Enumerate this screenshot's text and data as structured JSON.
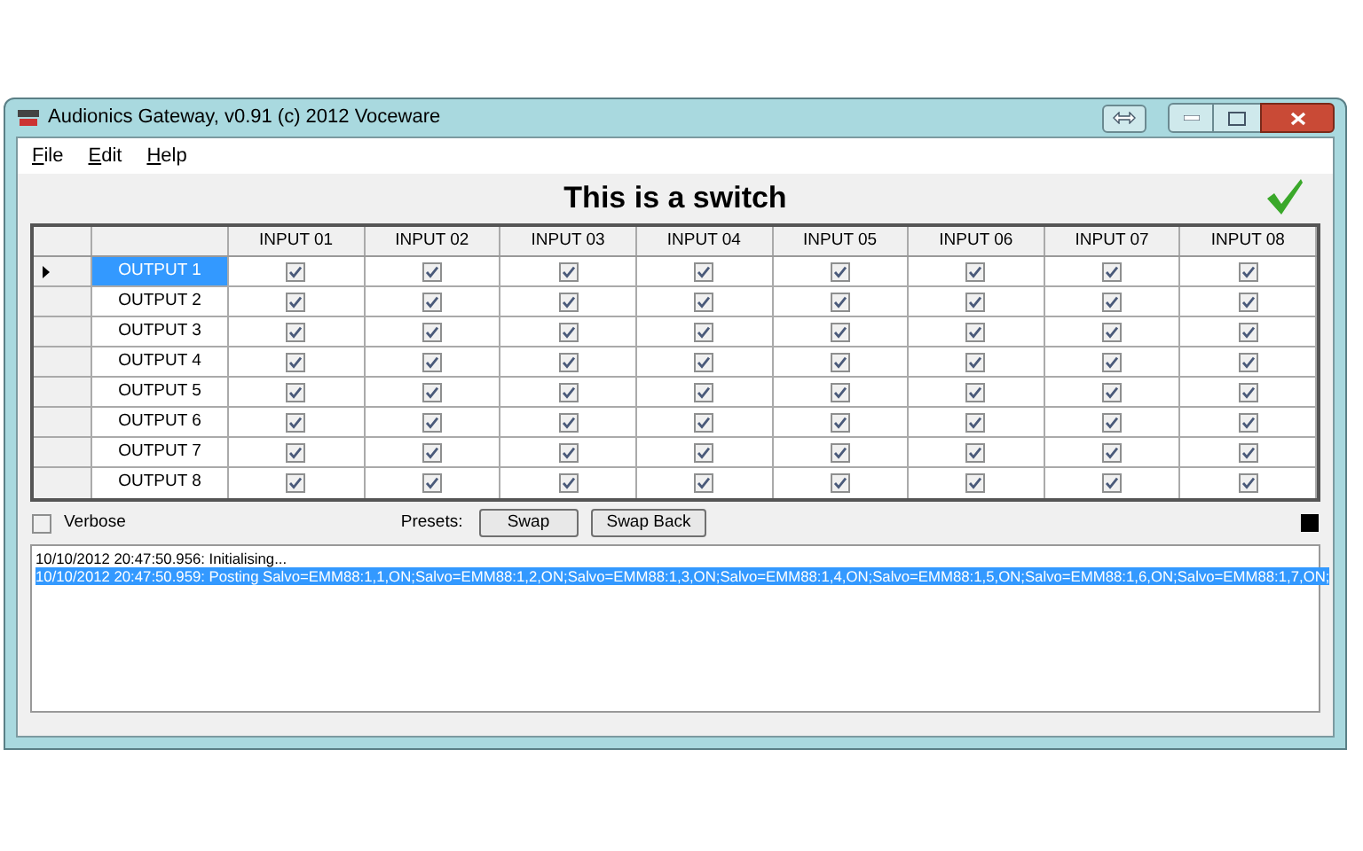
{
  "window": {
    "title": "Audionics Gateway, v0.91 (c) 2012 Voceware"
  },
  "menu": [
    {
      "label": "File"
    },
    {
      "label": "Edit"
    },
    {
      "label": "Help"
    }
  ],
  "heading": "This is a switch",
  "grid": {
    "columns": [
      "INPUT 01",
      "INPUT 02",
      "INPUT 03",
      "INPUT 04",
      "INPUT 05",
      "INPUT 06",
      "INPUT 07",
      "INPUT 08"
    ],
    "rows": [
      {
        "label": "OUTPUT 1",
        "current": true,
        "selected": true,
        "cells": [
          {
            "checked": true
          },
          {
            "checked": true
          },
          {
            "checked": true
          },
          {
            "checked": true
          },
          {
            "checked": true
          },
          {
            "checked": true
          },
          {
            "checked": true
          },
          {
            "checked": true
          }
        ]
      },
      {
        "label": "OUTPUT 2",
        "current": false,
        "selected": false,
        "cells": [
          {
            "checked": true
          },
          {
            "checked": true
          },
          {
            "checked": true
          },
          {
            "checked": true
          },
          {
            "checked": true
          },
          {
            "checked": true
          },
          {
            "checked": true
          },
          {
            "checked": true
          }
        ]
      },
      {
        "label": "OUTPUT 3",
        "current": false,
        "selected": false,
        "cells": [
          {
            "checked": true
          },
          {
            "checked": true
          },
          {
            "checked": true
          },
          {
            "checked": true
          },
          {
            "checked": true
          },
          {
            "checked": true
          },
          {
            "checked": true
          },
          {
            "checked": true
          }
        ]
      },
      {
        "label": "OUTPUT 4",
        "current": false,
        "selected": false,
        "cells": [
          {
            "checked": true
          },
          {
            "checked": true
          },
          {
            "checked": true
          },
          {
            "checked": true
          },
          {
            "checked": true
          },
          {
            "checked": true
          },
          {
            "checked": true
          },
          {
            "checked": true
          }
        ]
      },
      {
        "label": "OUTPUT 5",
        "current": false,
        "selected": false,
        "cells": [
          {
            "checked": true
          },
          {
            "checked": true
          },
          {
            "checked": true
          },
          {
            "checked": true
          },
          {
            "checked": true
          },
          {
            "checked": true
          },
          {
            "checked": true
          },
          {
            "checked": true
          }
        ]
      },
      {
        "label": "OUTPUT 6",
        "current": false,
        "selected": false,
        "cells": [
          {
            "checked": true
          },
          {
            "checked": true
          },
          {
            "checked": true
          },
          {
            "checked": true
          },
          {
            "checked": true
          },
          {
            "checked": true
          },
          {
            "checked": true
          },
          {
            "checked": true
          }
        ]
      },
      {
        "label": "OUTPUT 7",
        "current": false,
        "selected": false,
        "cells": [
          {
            "checked": true
          },
          {
            "checked": true
          },
          {
            "checked": true
          },
          {
            "checked": true
          },
          {
            "checked": true
          },
          {
            "checked": true
          },
          {
            "checked": true
          },
          {
            "checked": true
          }
        ]
      },
      {
        "label": "OUTPUT 8",
        "current": false,
        "selected": false,
        "cells": [
          {
            "checked": true
          },
          {
            "checked": true
          },
          {
            "checked": true
          },
          {
            "checked": true
          },
          {
            "checked": true
          },
          {
            "checked": true
          },
          {
            "checked": true
          },
          {
            "checked": true
          }
        ]
      }
    ]
  },
  "verbose": {
    "label": "Verbose",
    "checked": false
  },
  "presets": {
    "label": "Presets:",
    "buttons": [
      "Swap",
      "Swap Back"
    ]
  },
  "log": [
    {
      "text": "10/10/2012 20:47:50.956: Initialising...",
      "selected": false
    },
    {
      "text": "10/10/2012 20:47:50.959: Posting Salvo=EMM88:1,1,ON;Salvo=EMM88:1,2,ON;Salvo=EMM88:1,3,ON;Salvo=EMM88:1,4,ON;Salvo=EMM88:1,5,ON;Salvo=EMM88:1,6,ON;Salvo=EMM88:1,7,ON;",
      "selected": true
    }
  ]
}
